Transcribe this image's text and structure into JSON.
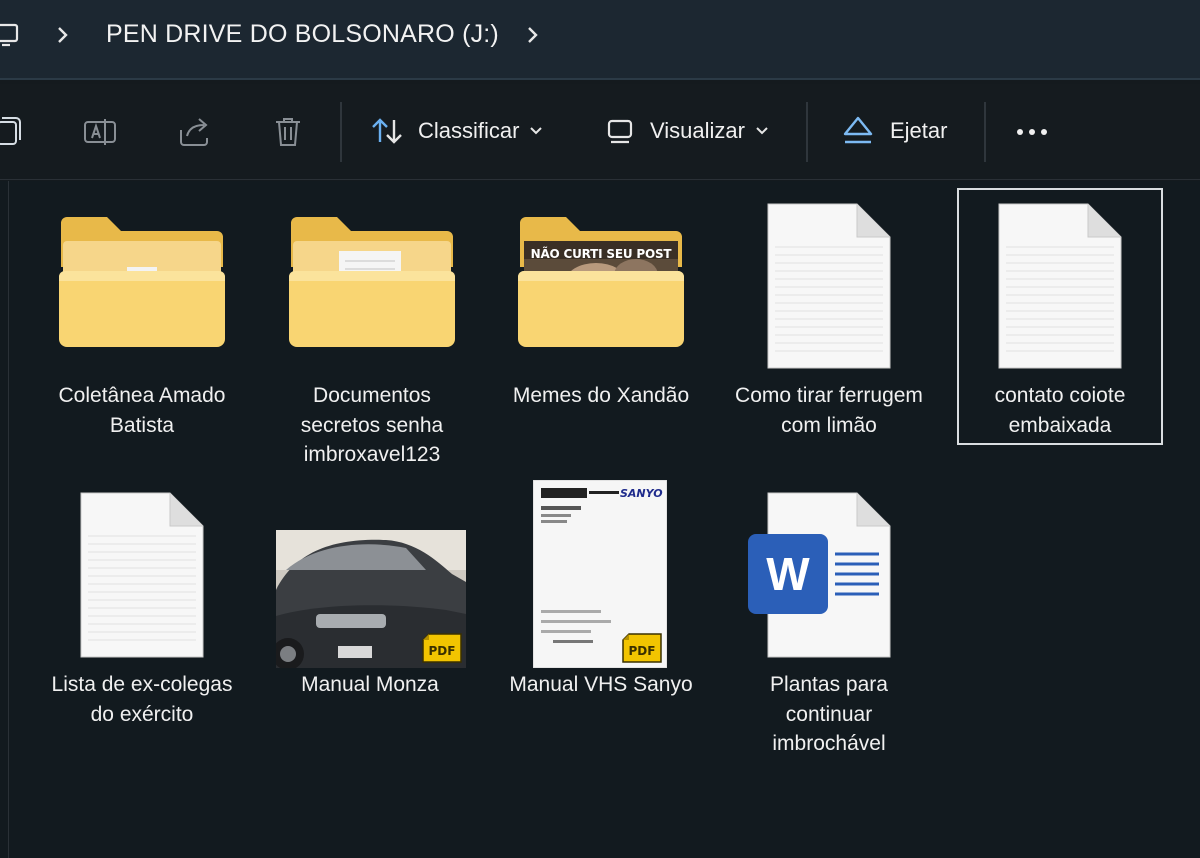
{
  "address_bar": {
    "location": "PEN DRIVE DO BOLSONARO (J:)"
  },
  "toolbar": {
    "sort_label": "Classificar",
    "view_label": "Visualizar",
    "eject_label": "Ejetar"
  },
  "items": [
    {
      "name": "Coletânea Amado Batista",
      "type": "folder"
    },
    {
      "name": "Documentos secretos senha imbroxavel123",
      "type": "folder"
    },
    {
      "name": "Memes do Xandão",
      "type": "folder",
      "thumbnail_caption": "NÃO CURTI SEU POST"
    },
    {
      "name": "Como tirar ferrugem com limão",
      "type": "text-document"
    },
    {
      "name": "contato coiote embaixada",
      "type": "text-document",
      "selected": true
    },
    {
      "name": "Lista de ex-colegas do exército",
      "type": "text-document"
    },
    {
      "name": "Manual Monza",
      "type": "pdf"
    },
    {
      "name": "Manual VHS Sanyo",
      "type": "pdf",
      "thumbnail_brand": "SANYO"
    },
    {
      "name": "Plantas para continuar imbrochável",
      "type": "word-document"
    }
  ],
  "colors": {
    "folder": "#f8d775",
    "selection_border": "#d9dde0",
    "word_blue": "#2b5fb8"
  }
}
